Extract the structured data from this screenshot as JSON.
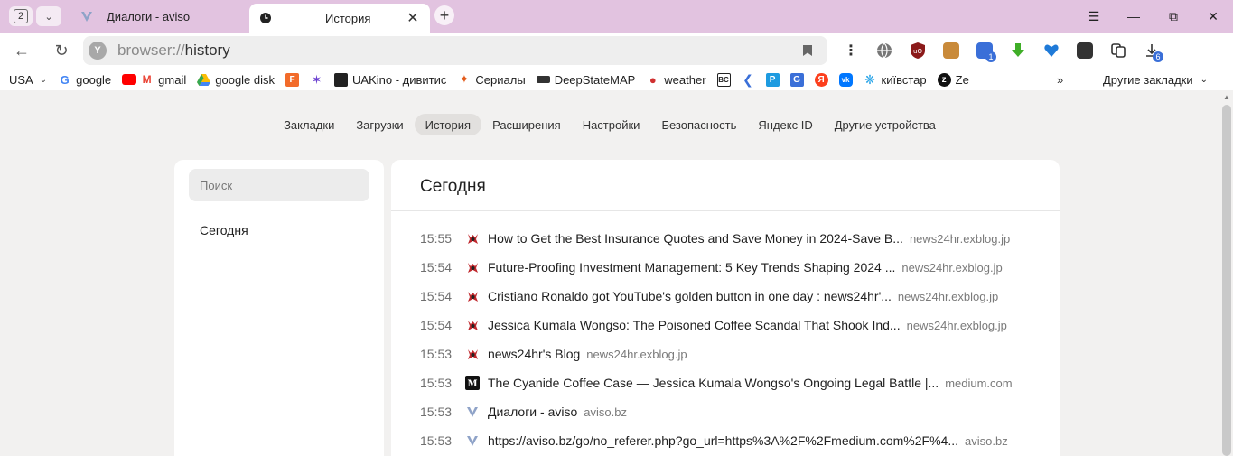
{
  "tabstrip": {
    "tab_count": "2",
    "tabs": [
      {
        "title": "Диалоги - aviso",
        "icon": "aviso-v-icon",
        "active": false
      },
      {
        "title": "История",
        "icon": "clock-icon",
        "active": true
      }
    ],
    "colors": {
      "strip": "#e2c3e0",
      "active_tab": "#ffffff"
    }
  },
  "address": {
    "scheme": "browser://",
    "path": "history"
  },
  "extensions": [
    {
      "name": "globe-extension-icon",
      "color": "#555555"
    },
    {
      "name": "ublock-icon",
      "color": "#b52020"
    },
    {
      "name": "package-extension-icon",
      "color": "#c98a3a"
    },
    {
      "name": "translate-extension-icon",
      "color": "#3a6fd8",
      "badge": "1"
    },
    {
      "name": "download-arrow-extension-icon",
      "color": "#3fae28"
    },
    {
      "name": "heart-shield-extension-icon",
      "color": "#1f7ad8"
    },
    {
      "name": "terminal-extension-icon",
      "color": "#333333"
    },
    {
      "name": "copy-extension-icon",
      "color": "#333333"
    }
  ],
  "downloads_badge": "6",
  "bookmarks": {
    "items": [
      {
        "label": "USA",
        "icon": "",
        "chevron": true
      },
      {
        "label": "google",
        "icon": "google-icon",
        "color": "#4285f4"
      },
      {
        "label": "gmail",
        "icon": "youtube-gmail-icon",
        "color": "#ea4335"
      },
      {
        "label": "google disk",
        "icon": "google-drive-icon",
        "color": "#fbbc04"
      },
      {
        "label": "",
        "icon": "f-orange-icon",
        "color": "#f26b2a"
      },
      {
        "label": "",
        "icon": "colorful-star-icon",
        "color": "#6a3fd0"
      },
      {
        "label": "UAKino - дивитис",
        "icon": "uakino-icon",
        "color": "#222222"
      },
      {
        "label": "Сериалы",
        "icon": "fox-icon",
        "color": "#e35b1a"
      },
      {
        "label": "DeepStateMAP",
        "icon": "deepstate-icon",
        "color": "#333333"
      },
      {
        "label": "weather",
        "icon": "thermometer-icon",
        "color": "#d03030"
      },
      {
        "label": "",
        "icon": "bc-icon",
        "color": "#222222"
      },
      {
        "label": "",
        "icon": "chevron-blue-icon",
        "color": "#3a6fd8"
      },
      {
        "label": "",
        "icon": "p-blue-icon",
        "color": "#1e9be0"
      },
      {
        "label": "",
        "icon": "translate-icon",
        "color": "#3a6fd8"
      },
      {
        "label": "",
        "icon": "yandex-icon",
        "color": "#fc3f1d"
      },
      {
        "label": "",
        "icon": "vk-icon",
        "color": "#0077ff"
      },
      {
        "label": "київстар",
        "icon": "kyivstar-icon",
        "color": "#2aa5e8"
      },
      {
        "label": "Ze",
        "icon": "z-icon",
        "color": "#111111"
      }
    ],
    "overflow": "»",
    "other": "Другие закладки"
  },
  "settings_nav": [
    {
      "label": "Закладки",
      "active": false
    },
    {
      "label": "Загрузки",
      "active": false
    },
    {
      "label": "История",
      "active": true
    },
    {
      "label": "Расширения",
      "active": false
    },
    {
      "label": "Настройки",
      "active": false
    },
    {
      "label": "Безопасность",
      "active": false
    },
    {
      "label": "Яндекс ID",
      "active": false
    },
    {
      "label": "Другие устройства",
      "active": false
    }
  ],
  "sidebar": {
    "search_placeholder": "Поиск",
    "today": "Сегодня"
  },
  "history": {
    "heading": "Сегодня",
    "rows": [
      {
        "time": "15:55",
        "title": "How to Get the Best Insurance Quotes and Save Money in 2024-Save B...",
        "host": "news24hr.exblog.jp",
        "icon": "exblog-icon"
      },
      {
        "time": "15:54",
        "title": "Future-Proofing Investment Management: 5 Key Trends Shaping 2024 ...",
        "host": "news24hr.exblog.jp",
        "icon": "exblog-icon"
      },
      {
        "time": "15:54",
        "title": "Cristiano Ronaldo got YouTube's golden button in one day : news24hr'...",
        "host": "news24hr.exblog.jp",
        "icon": "exblog-icon"
      },
      {
        "time": "15:54",
        "title": "Jessica Kumala Wongso: The Poisoned Coffee Scandal That Shook Ind...",
        "host": "news24hr.exblog.jp",
        "icon": "exblog-icon"
      },
      {
        "time": "15:53",
        "title": "news24hr's Blog",
        "host": "news24hr.exblog.jp",
        "icon": "exblog-icon"
      },
      {
        "time": "15:53",
        "title": "The Cyanide Coffee Case — Jessica Kumala Wongso's Ongoing Legal Battle |...",
        "host": "medium.com",
        "icon": "medium-icon"
      },
      {
        "time": "15:53",
        "title": "Диалоги - aviso",
        "host": "aviso.bz",
        "icon": "aviso-v-icon"
      },
      {
        "time": "15:53",
        "title": "https://aviso.bz/go/no_referer.php?go_url=https%3A%2F%2Fmedium.com%2F%4...",
        "host": "aviso.bz",
        "icon": "aviso-v-icon"
      }
    ]
  }
}
